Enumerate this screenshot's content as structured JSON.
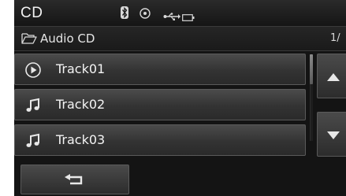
{
  "status_bar": {
    "mode": "CD",
    "icons": [
      "bluetooth-icon",
      "disc-icon",
      "usb-icon",
      "battery-icon"
    ]
  },
  "header": {
    "folder_icon": "folder-icon",
    "title": "Audio CD",
    "page_indicator": "1/"
  },
  "tracks": [
    {
      "label": "Track01",
      "icon": "play-icon",
      "playing": true
    },
    {
      "label": "Track02",
      "icon": "music-note-icon",
      "playing": false
    },
    {
      "label": "Track03",
      "icon": "music-note-icon",
      "playing": false
    }
  ],
  "scroll": {
    "up_icon": "arrow-up-icon",
    "down_icon": "arrow-down-icon"
  },
  "footer": {
    "back_icon": "back-arrow-icon"
  },
  "colors": {
    "background": "#141414",
    "text": "#f4f4f4",
    "button": "#3a3a3a"
  }
}
